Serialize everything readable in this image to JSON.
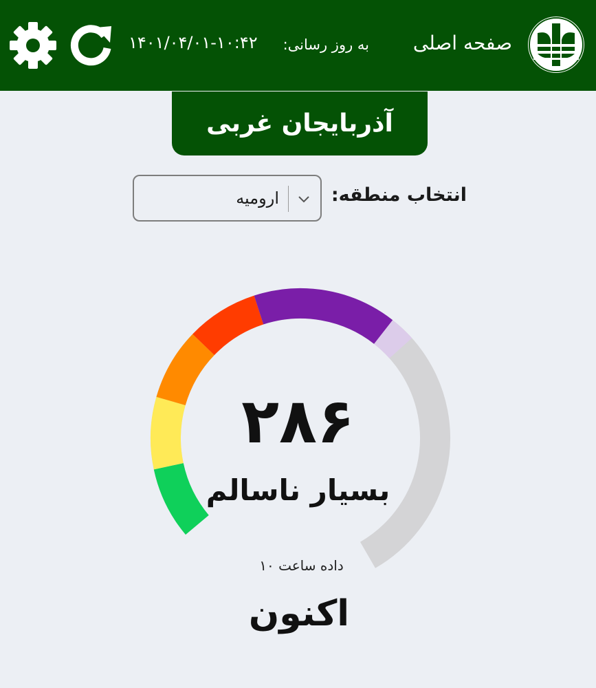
{
  "header": {
    "home_label": "صفحه اصلی",
    "updated_label": "به روز رسانی:",
    "updated_value": "۱۴۰۱/۰۴/۰۱-۱۰:۴۲",
    "background_color": "#045205",
    "refresh_icon": "refresh-icon",
    "settings_icon": "gear-icon",
    "logo_icon": "environment-logo-icon"
  },
  "province": {
    "name": "آذربایجان غربی"
  },
  "region": {
    "label": "انتخاب منطقه:",
    "selected": "ارومیه"
  },
  "aqi": {
    "value": "۲۸۶",
    "numeric_value": 286,
    "max": 500,
    "status": "بسیار ناسالم",
    "data_hour": "داده ساعت ۱۰",
    "period_label": "اکنون",
    "bands": [
      {
        "from": 0,
        "to": 50,
        "color": "#0fd05a"
      },
      {
        "from": 50,
        "to": 100,
        "color": "#ffea57"
      },
      {
        "from": 100,
        "to": 150,
        "color": "#ff8a00"
      },
      {
        "from": 150,
        "to": 200,
        "color": "#ff3c00"
      },
      {
        "from": 200,
        "to": 300,
        "color": "#7a1ea8"
      }
    ],
    "highlight_color": "#dcccea",
    "track_color": "#d4d4d6"
  }
}
